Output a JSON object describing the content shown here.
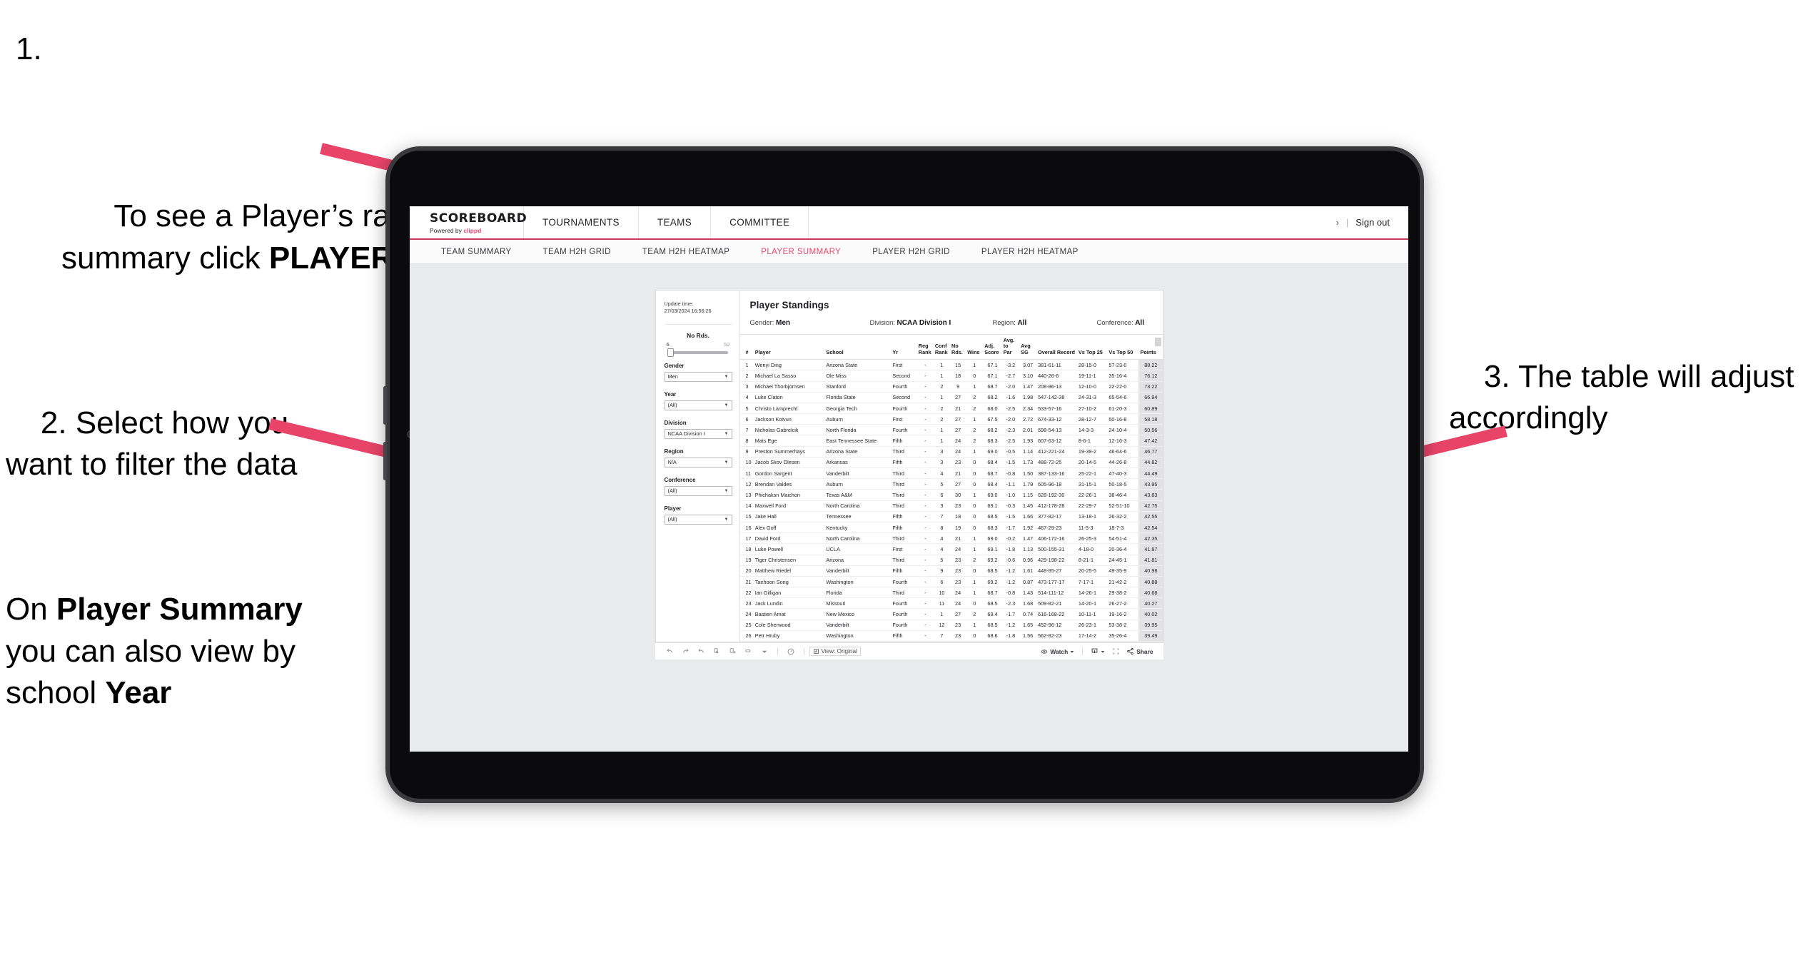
{
  "annotations": {
    "step1": {
      "number": "1.",
      "text_before": "To see a Player’s rankings summary click ",
      "text_bold": "PLAYER SUMMARY"
    },
    "step2": {
      "line": "2. Select how you want to filter the data"
    },
    "step2b": {
      "pre": "On ",
      "bold1": "Player Summary",
      "mid": " you can also view by school ",
      "bold2": "Year"
    },
    "step3": {
      "line": "3. The table will adjust accordingly"
    }
  },
  "app": {
    "brand": {
      "logo": "SCOREBOARD",
      "powered_by": "Powered by ",
      "clippd": "clippd"
    },
    "topnav": [
      {
        "label": "TOURNAMENTS"
      },
      {
        "label": "TEAMS"
      },
      {
        "label": "COMMITTEE"
      }
    ],
    "topbar_right": {
      "chevron": "›",
      "separator": "|",
      "sign_out": "Sign out"
    },
    "subnav": [
      {
        "label": "TEAM SUMMARY",
        "active": false
      },
      {
        "label": "TEAM H2H GRID",
        "active": false
      },
      {
        "label": "TEAM H2H HEATMAP",
        "active": false
      },
      {
        "label": "PLAYER SUMMARY",
        "active": true
      },
      {
        "label": "PLAYER H2H GRID",
        "active": false
      },
      {
        "label": "PLAYER H2H HEATMAP",
        "active": false
      }
    ]
  },
  "filters": {
    "update_label": "Update time:",
    "update_value": "27/03/2024 16:56:26",
    "slider": {
      "label": "No Rds.",
      "min": "6",
      "max": "52"
    },
    "controls": [
      {
        "label": "Gender",
        "value": "Men"
      },
      {
        "label": "Year",
        "value": "(All)"
      },
      {
        "label": "Division",
        "value": "NCAA Division I"
      },
      {
        "label": "Region",
        "value": "N/A"
      },
      {
        "label": "Conference",
        "value": "(All)"
      },
      {
        "label": "Player",
        "value": "(All)"
      }
    ]
  },
  "dashboard": {
    "title": "Player Standings",
    "summary": [
      {
        "label": "Gender:",
        "value": "Men"
      },
      {
        "label": "Division:",
        "value": "NCAA Division I"
      },
      {
        "label": "Region:",
        "value": "All"
      },
      {
        "label": "Conference:",
        "value": "All"
      }
    ],
    "columns": [
      "#",
      "Player",
      "School",
      "Yr",
      "Reg Rank",
      "Conf Rank",
      "No Rds.",
      "Wins",
      "Adj. Score",
      "Avg. to Par",
      "Avg SG",
      "Overall Record",
      "Vs Top 25",
      "Vs Top 50",
      "Points"
    ],
    "rows": [
      {
        "rank": "1",
        "player": "Wenyi Ding",
        "school": "Arizona State",
        "yr": "First",
        "reg": "-",
        "conf": "1",
        "rds": "15",
        "wins": "1",
        "adj": "67.1",
        "par": "-3.2",
        "sg": "3.07",
        "record": "381-61-11",
        "t25": "28-15-0",
        "t50": "57-23-0",
        "points": "88.22"
      },
      {
        "rank": "2",
        "player": "Michael La Sasso",
        "school": "Ole Miss",
        "yr": "Second",
        "reg": "-",
        "conf": "1",
        "rds": "18",
        "wins": "0",
        "adj": "67.1",
        "par": "-2.7",
        "sg": "3.10",
        "record": "440-26-6",
        "t25": "19-11-1",
        "t50": "35-16-4",
        "points": "76.12"
      },
      {
        "rank": "3",
        "player": "Michael Thorbjornsen",
        "school": "Stanford",
        "yr": "Fourth",
        "reg": "-",
        "conf": "2",
        "rds": "9",
        "wins": "1",
        "adj": "68.7",
        "par": "-2.0",
        "sg": "1.47",
        "record": "208-86-13",
        "t25": "12-10-0",
        "t50": "22-22-0",
        "points": "73.22"
      },
      {
        "rank": "4",
        "player": "Luke Claton",
        "school": "Florida State",
        "yr": "Second",
        "reg": "-",
        "conf": "1",
        "rds": "27",
        "wins": "2",
        "adj": "68.2",
        "par": "-1.6",
        "sg": "1.98",
        "record": "547-142-38",
        "t25": "24-31-3",
        "t50": "65-54-6",
        "points": "66.94"
      },
      {
        "rank": "5",
        "player": "Christo Lamprecht",
        "school": "Georgia Tech",
        "yr": "Fourth",
        "reg": "-",
        "conf": "2",
        "rds": "21",
        "wins": "2",
        "adj": "68.0",
        "par": "-2.5",
        "sg": "2.34",
        "record": "533-57-16",
        "t25": "27-10-2",
        "t50": "61-20-3",
        "points": "60.89"
      },
      {
        "rank": "6",
        "player": "Jackson Koivun",
        "school": "Auburn",
        "yr": "First",
        "reg": "-",
        "conf": "2",
        "rds": "27",
        "wins": "1",
        "adj": "67.5",
        "par": "-2.0",
        "sg": "2.72",
        "record": "674-33-12",
        "t25": "28-12-7",
        "t50": "50-16-8",
        "points": "58.18"
      },
      {
        "rank": "7",
        "player": "Nicholas Gabrelcik",
        "school": "North Florida",
        "yr": "Fourth",
        "reg": "-",
        "conf": "1",
        "rds": "27",
        "wins": "2",
        "adj": "68.2",
        "par": "-2.3",
        "sg": "2.01",
        "record": "698-54-13",
        "t25": "14-3-3",
        "t50": "24-10-4",
        "points": "50.56"
      },
      {
        "rank": "8",
        "player": "Mats Ege",
        "school": "East Tennessee State",
        "yr": "Fifth",
        "reg": "-",
        "conf": "1",
        "rds": "24",
        "wins": "2",
        "adj": "68.3",
        "par": "-2.5",
        "sg": "1.93",
        "record": "607-63-12",
        "t25": "8-6-1",
        "t50": "12-16-3",
        "points": "47.42"
      },
      {
        "rank": "9",
        "player": "Preston Summerhays",
        "school": "Arizona State",
        "yr": "Third",
        "reg": "-",
        "conf": "3",
        "rds": "24",
        "wins": "1",
        "adj": "69.0",
        "par": "-0.5",
        "sg": "1.14",
        "record": "412-221-24",
        "t25": "19-39-2",
        "t50": "46-64-6",
        "points": "46.77"
      },
      {
        "rank": "10",
        "player": "Jacob Skov Olesen",
        "school": "Arkansas",
        "yr": "Fifth",
        "reg": "-",
        "conf": "3",
        "rds": "23",
        "wins": "0",
        "adj": "68.4",
        "par": "-1.5",
        "sg": "1.73",
        "record": "488-72-25",
        "t25": "20-14-5",
        "t50": "44-26-8",
        "points": "44.82"
      },
      {
        "rank": "11",
        "player": "Gordon Sargent",
        "school": "Vanderbilt",
        "yr": "Third",
        "reg": "-",
        "conf": "4",
        "rds": "21",
        "wins": "0",
        "adj": "68.7",
        "par": "-0.8",
        "sg": "1.50",
        "record": "387-133-16",
        "t25": "25-22-1",
        "t50": "47-40-3",
        "points": "44.49"
      },
      {
        "rank": "12",
        "player": "Brendan Valdes",
        "school": "Auburn",
        "yr": "Third",
        "reg": "-",
        "conf": "5",
        "rds": "27",
        "wins": "0",
        "adj": "68.4",
        "par": "-1.1",
        "sg": "1.79",
        "record": "605-96-18",
        "t25": "31-15-1",
        "t50": "50-18-5",
        "points": "43.95"
      },
      {
        "rank": "13",
        "player": "Phichaksn Maichon",
        "school": "Texas A&M",
        "yr": "Third",
        "reg": "-",
        "conf": "6",
        "rds": "30",
        "wins": "1",
        "adj": "69.0",
        "par": "-1.0",
        "sg": "1.15",
        "record": "628-192-30",
        "t25": "22-26-1",
        "t50": "38-46-4",
        "points": "43.83"
      },
      {
        "rank": "14",
        "player": "Maxwell Ford",
        "school": "North Carolina",
        "yr": "Third",
        "reg": "-",
        "conf": "3",
        "rds": "23",
        "wins": "0",
        "adj": "69.1",
        "par": "-0.3",
        "sg": "1.45",
        "record": "412-178-28",
        "t25": "22-29-7",
        "t50": "52-51-10",
        "points": "42.75"
      },
      {
        "rank": "15",
        "player": "Jake Hall",
        "school": "Tennessee",
        "yr": "Fifth",
        "reg": "-",
        "conf": "7",
        "rds": "18",
        "wins": "0",
        "adj": "68.5",
        "par": "-1.5",
        "sg": "1.66",
        "record": "377-82-17",
        "t25": "13-18-1",
        "t50": "26-32-2",
        "points": "42.55"
      },
      {
        "rank": "16",
        "player": "Alex Goff",
        "school": "Kentucky",
        "yr": "Fifth",
        "reg": "-",
        "conf": "8",
        "rds": "19",
        "wins": "0",
        "adj": "68.3",
        "par": "-1.7",
        "sg": "1.92",
        "record": "467-29-23",
        "t25": "11-5-3",
        "t50": "18-7-3",
        "points": "42.54"
      },
      {
        "rank": "17",
        "player": "David Ford",
        "school": "North Carolina",
        "yr": "Third",
        "reg": "-",
        "conf": "4",
        "rds": "21",
        "wins": "1",
        "adj": "69.0",
        "par": "-0.2",
        "sg": "1.47",
        "record": "406-172-16",
        "t25": "26-25-3",
        "t50": "54-51-4",
        "points": "42.35"
      },
      {
        "rank": "18",
        "player": "Luke Powell",
        "school": "UCLA",
        "yr": "First",
        "reg": "-",
        "conf": "4",
        "rds": "24",
        "wins": "1",
        "adj": "69.1",
        "par": "-1.8",
        "sg": "1.13",
        "record": "500-155-31",
        "t25": "4-18-0",
        "t50": "20-36-4",
        "points": "41.87"
      },
      {
        "rank": "19",
        "player": "Tiger Christensen",
        "school": "Arizona",
        "yr": "Third",
        "reg": "-",
        "conf": "5",
        "rds": "23",
        "wins": "2",
        "adj": "69.2",
        "par": "-0.6",
        "sg": "0.96",
        "record": "429-198-22",
        "t25": "8-21-1",
        "t50": "24-45-1",
        "points": "41.81"
      },
      {
        "rank": "20",
        "player": "Matthew Riedel",
        "school": "Vanderbilt",
        "yr": "Fifth",
        "reg": "-",
        "conf": "9",
        "rds": "23",
        "wins": "0",
        "adj": "68.5",
        "par": "-1.2",
        "sg": "1.61",
        "record": "448-85-27",
        "t25": "20-25-5",
        "t50": "49-35-9",
        "points": "40.98"
      },
      {
        "rank": "21",
        "player": "Taehoon Song",
        "school": "Washington",
        "yr": "Fourth",
        "reg": "-",
        "conf": "6",
        "rds": "23",
        "wins": "1",
        "adj": "69.2",
        "par": "-1.2",
        "sg": "0.87",
        "record": "473-177-17",
        "t25": "7-17-1",
        "t50": "21-42-2",
        "points": "40.88"
      },
      {
        "rank": "22",
        "player": "Ian Gilligan",
        "school": "Florida",
        "yr": "Third",
        "reg": "-",
        "conf": "10",
        "rds": "24",
        "wins": "1",
        "adj": "68.7",
        "par": "-0.8",
        "sg": "1.43",
        "record": "514-111-12",
        "t25": "14-26-1",
        "t50": "29-38-2",
        "points": "40.68"
      },
      {
        "rank": "23",
        "player": "Jack Lundin",
        "school": "Missouri",
        "yr": "Fourth",
        "reg": "-",
        "conf": "11",
        "rds": "24",
        "wins": "0",
        "adj": "68.5",
        "par": "-2.3",
        "sg": "1.68",
        "record": "509-82-21",
        "t25": "14-20-1",
        "t50": "26-27-2",
        "points": "40.27"
      },
      {
        "rank": "24",
        "player": "Bastien Amat",
        "school": "New Mexico",
        "yr": "Fourth",
        "reg": "-",
        "conf": "1",
        "rds": "27",
        "wins": "2",
        "adj": "69.4",
        "par": "-1.7",
        "sg": "0.74",
        "record": "616-168-22",
        "t25": "10-11-1",
        "t50": "19-16-2",
        "points": "40.02"
      },
      {
        "rank": "25",
        "player": "Cole Sherwood",
        "school": "Vanderbilt",
        "yr": "Fourth",
        "reg": "-",
        "conf": "12",
        "rds": "23",
        "wins": "1",
        "adj": "68.5",
        "par": "-1.2",
        "sg": "1.65",
        "record": "452-96-12",
        "t25": "26-23-1",
        "t50": "53-38-2",
        "points": "39.95"
      },
      {
        "rank": "26",
        "player": "Petr Hruby",
        "school": "Washington",
        "yr": "Fifth",
        "reg": "-",
        "conf": "7",
        "rds": "23",
        "wins": "0",
        "adj": "68.6",
        "par": "-1.8",
        "sg": "1.56",
        "record": "562-82-23",
        "t25": "17-14-2",
        "t50": "35-26-4",
        "points": "39.49"
      }
    ]
  },
  "bottombar": {
    "view_label": "View: Original",
    "watch_label": "Watch",
    "share_label": "Share"
  },
  "colors": {
    "accent_pink": "#e8476b",
    "arrow_pink": "#e8446a",
    "topbar_underline": "#c8385a"
  }
}
